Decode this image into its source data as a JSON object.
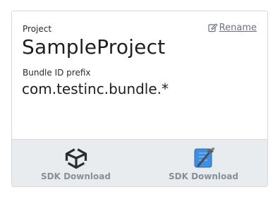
{
  "project": {
    "label": "Project",
    "name": "SampleProject",
    "rename_label": "Rename"
  },
  "bundle": {
    "label": "Bundle ID prefix",
    "value": "com.testinc.bundle.*"
  },
  "downloads": [
    {
      "icon": "unity-icon",
      "label": "SDK Download"
    },
    {
      "icon": "xcode-icon",
      "label": "SDK Download"
    }
  ],
  "colors": {
    "footer_bg": "#e9ecef",
    "border": "#d6d9dc",
    "label_gray": "#8a8f95",
    "xcode_blue": "#3f8fe0"
  }
}
